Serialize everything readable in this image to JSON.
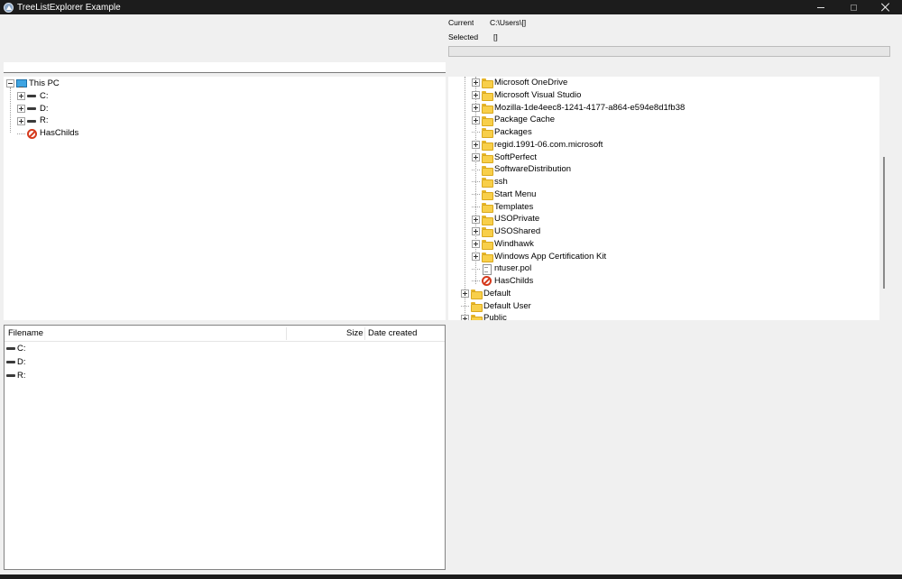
{
  "window": {
    "title": "TreeListExplorer Example",
    "controls": [
      "minimize",
      "maximize",
      "close"
    ]
  },
  "info": {
    "current_label": "Current",
    "current_value": "C:\\Users\\[]",
    "selected_label": "Selected",
    "selected_value": "[]"
  },
  "path_input": {
    "value": ""
  },
  "left_tree": {
    "items": [
      {
        "label": "This PC",
        "icon": "pc-icon",
        "expander": "minus",
        "level": 0
      },
      {
        "label": "C:",
        "icon": "drive-icon",
        "expander": "plus",
        "level": 1
      },
      {
        "label": "D:",
        "icon": "drive-icon",
        "expander": "plus",
        "level": 1
      },
      {
        "label": "R:",
        "icon": "drive-icon",
        "expander": "plus",
        "level": 1
      },
      {
        "label": "HasChilds",
        "icon": "no-entry-icon",
        "expander": "none",
        "level": 1
      }
    ]
  },
  "right_tree": {
    "items": [
      {
        "label": "Microsoft OneDrive",
        "icon": "folder-icon",
        "expander": "plus"
      },
      {
        "label": "Microsoft Visual Studio",
        "icon": "folder-icon",
        "expander": "plus"
      },
      {
        "label": "Mozilla-1de4eec8-1241-4177-a864-e594e8d1fb38",
        "icon": "folder-icon",
        "expander": "plus"
      },
      {
        "label": "Package Cache",
        "icon": "folder-icon",
        "expander": "plus"
      },
      {
        "label": "Packages",
        "icon": "folder-icon",
        "expander": "none"
      },
      {
        "label": "regid.1991-06.com.microsoft",
        "icon": "folder-icon",
        "expander": "plus"
      },
      {
        "label": "SoftPerfect",
        "icon": "folder-icon",
        "expander": "plus"
      },
      {
        "label": "SoftwareDistribution",
        "icon": "folder-icon",
        "expander": "none"
      },
      {
        "label": "ssh",
        "icon": "folder-icon",
        "expander": "none"
      },
      {
        "label": "Start Menu",
        "icon": "folder-icon",
        "expander": "none"
      },
      {
        "label": "Templates",
        "icon": "folder-icon",
        "expander": "none"
      },
      {
        "label": "USOPrivate",
        "icon": "folder-icon",
        "expander": "plus"
      },
      {
        "label": "USOShared",
        "icon": "folder-icon",
        "expander": "plus"
      },
      {
        "label": "Windhawk",
        "icon": "folder-icon",
        "expander": "plus"
      },
      {
        "label": "Windows App Certification Kit",
        "icon": "folder-icon",
        "expander": "plus"
      },
      {
        "label": "ntuser.pol",
        "icon": "file-icon",
        "expander": "none"
      },
      {
        "label": "HasChilds",
        "icon": "no-entry-icon",
        "expander": "none"
      },
      {
        "label": "Default",
        "icon": "folder-icon",
        "expander": "plus"
      },
      {
        "label": "Default User",
        "icon": "folder-icon",
        "expander": "none"
      },
      {
        "label": "Public",
        "icon": "folder-icon",
        "expander": "plus"
      }
    ]
  },
  "file_list": {
    "columns": {
      "filename": "Filename",
      "size": "Size",
      "date_created": "Date created"
    },
    "rows": [
      {
        "name": "C:",
        "icon": "drive-icon"
      },
      {
        "name": "D:",
        "icon": "drive-icon"
      },
      {
        "name": "R:",
        "icon": "drive-icon"
      }
    ]
  }
}
